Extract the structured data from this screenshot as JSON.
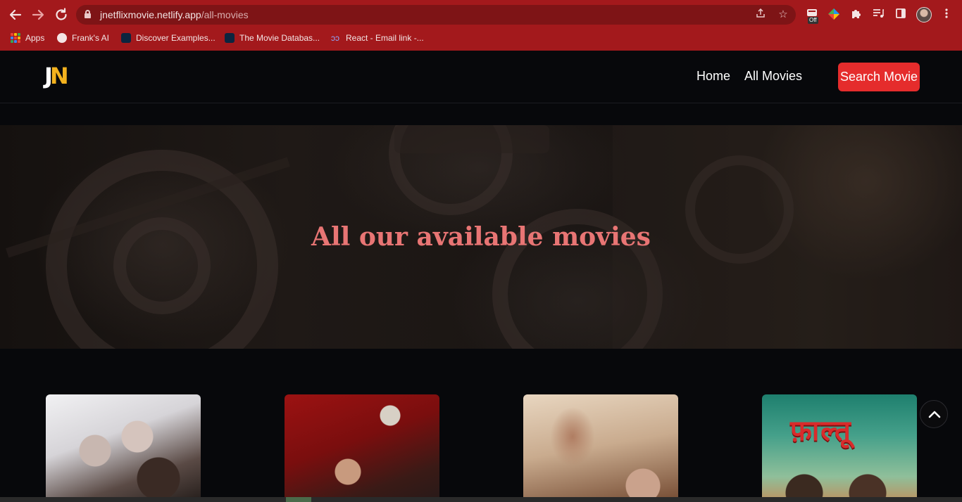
{
  "browser": {
    "url_host": "jnetflixmovie.netlify.app",
    "url_path": "/all-movies",
    "extension_badge": "Off",
    "bookmarks": [
      {
        "label": "Apps"
      },
      {
        "label": "Frank's AI"
      },
      {
        "label": "Discover Examples..."
      },
      {
        "label": "The Movie Databas..."
      },
      {
        "label": "React - Email link -..."
      }
    ]
  },
  "site": {
    "logo_j": "J",
    "logo_n": "N",
    "nav": {
      "home": "Home",
      "all_movies": "All Movies",
      "search": "Search Movie"
    },
    "accent_color": "#e52c2c",
    "logo_accent_color": "#f3b21e"
  },
  "hero": {
    "title": "All our available movies",
    "title_color": "#e87574"
  },
  "movies": [
    {
      "poster": "poster-1"
    },
    {
      "poster": "poster-2"
    },
    {
      "poster": "poster-3"
    },
    {
      "poster": "poster-4",
      "title_art": "फ़ाल्तू"
    }
  ],
  "icons": {
    "back": "arrow-left-icon",
    "forward": "arrow-right-icon",
    "reload": "reload-icon",
    "share": "share-icon",
    "star": "star-icon",
    "extensions": "puzzle-icon",
    "scroll_top": "chevron-up-icon"
  }
}
